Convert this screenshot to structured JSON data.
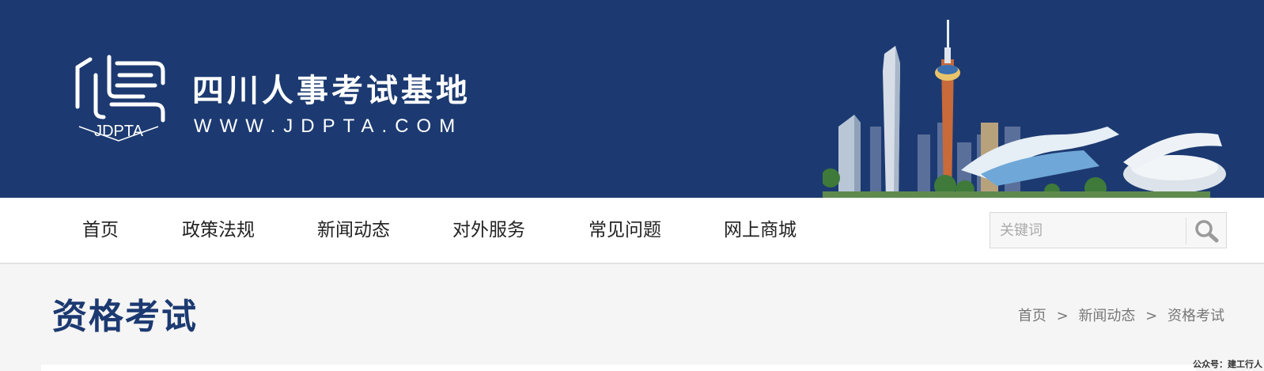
{
  "header": {
    "site_title": "四川人事考试基地",
    "site_url": "WWW.JDPTA.COM",
    "logo_text": "JDPTA"
  },
  "nav": {
    "items": [
      {
        "label": "首页"
      },
      {
        "label": "政策法规"
      },
      {
        "label": "新闻动态"
      },
      {
        "label": "对外服务"
      },
      {
        "label": "常见问题"
      },
      {
        "label": "网上商城"
      }
    ]
  },
  "search": {
    "placeholder": "关键词",
    "icon": "search-icon"
  },
  "page": {
    "title": "资格考试"
  },
  "breadcrumb": {
    "items": [
      "首页",
      "新闻动态",
      "资格考试"
    ],
    "separator": ">"
  },
  "watermark": "公众号：建工行人",
  "colors": {
    "brand_blue": "#1c3a71",
    "nav_bg": "#ffffff",
    "page_bg": "#f5f5f5"
  }
}
